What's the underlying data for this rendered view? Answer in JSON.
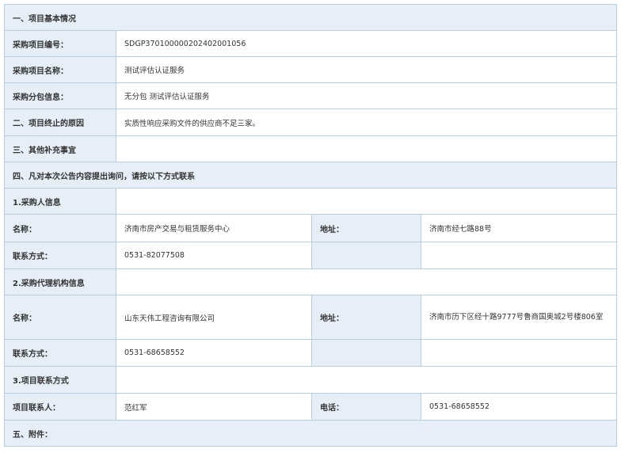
{
  "sections": {
    "basic": "一、项目基本情况",
    "reason_label": "二、项目终止的原因",
    "reason_value": "实质性响应采购文件的供应商不足三家。",
    "other_label": "三、其他补充事宜",
    "contact": "四、凡对本次公告内容提出询问，请按以下方式联系",
    "attachments": "五、附件："
  },
  "project": {
    "code_label": "采购项目编号：",
    "code_value": "SDGP370100000202402001056",
    "name_label": "采购项目名称：",
    "name_value": "测试评估认证服务",
    "package_label": "采购分包信息：",
    "package_value": "无分包 测试评估认证服务"
  },
  "purchaser": {
    "title": "1.采购人信息",
    "name_label": "名称：",
    "name_value": "济南市房产交易与租赁服务中心",
    "address_label": "地址：",
    "address_value": "济南市经七路88号",
    "phone_label": "联系方式：",
    "phone_value": "0531-82077508"
  },
  "agency": {
    "title": "2.采购代理机构信息",
    "name_label": "名称：",
    "name_value": "山东天伟工程咨询有限公司",
    "address_label": "地址：",
    "address_value": "济南市历下区经十路9777号鲁商国奥城2号楼806室",
    "phone_label": "联系方式：",
    "phone_value": "0531-68658552"
  },
  "project_contact": {
    "title": "3.项目联系方式",
    "person_label": "项目联系人：",
    "person_value": "范红军",
    "phone_label": "电话：",
    "phone_value": "0531-68658552"
  }
}
